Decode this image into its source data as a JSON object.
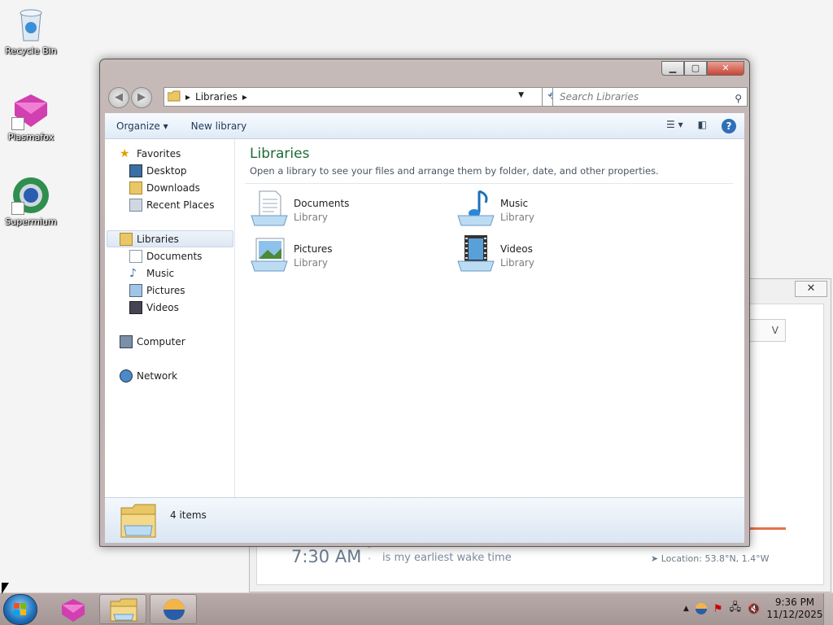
{
  "desktop": {
    "icons": [
      {
        "label": "Recycle Bin",
        "icon": "recycle-bin-icon"
      },
      {
        "label": "Plasmafox",
        "icon": "plasmafox-icon"
      },
      {
        "label": "Supermium",
        "icon": "supermium-icon"
      }
    ]
  },
  "background_app": {
    "wake_time": "7:30 AM",
    "wake_text": "is my earliest wake time",
    "location": "Location: 53.8°N, 1.4°W",
    "dropdown_glyph": "V",
    "close_glyph": "✕"
  },
  "explorer": {
    "address": {
      "root_arrow": "▸",
      "crumb": "Libraries",
      "after_arrow": "▸"
    },
    "search_placeholder": "Search Libraries",
    "toolbar": {
      "organize": "Organize ▾",
      "new_library": "New library"
    },
    "nav": {
      "favorites": "Favorites",
      "desktop": "Desktop",
      "downloads": "Downloads",
      "recent_places": "Recent Places",
      "libraries": "Libraries",
      "documents": "Documents",
      "music": "Music",
      "pictures": "Pictures",
      "videos": "Videos",
      "computer": "Computer",
      "network": "Network"
    },
    "content": {
      "title": "Libraries",
      "description": "Open a library to see your files and arrange them by folder, date, and other properties.",
      "items": [
        {
          "name": "Documents",
          "type": "Library",
          "icon": "documents-library-icon"
        },
        {
          "name": "Music",
          "type": "Library",
          "icon": "music-library-icon"
        },
        {
          "name": "Pictures",
          "type": "Library",
          "icon": "pictures-library-icon"
        },
        {
          "name": "Videos",
          "type": "Library",
          "icon": "videos-library-icon"
        }
      ]
    },
    "details": {
      "count": "4 items"
    }
  },
  "taskbar": {
    "clock_time": "9:36 PM",
    "clock_date": "11/12/2025"
  },
  "colors": {
    "accent_title": "#1e6b34",
    "taskbar": "#b0a2a0"
  }
}
